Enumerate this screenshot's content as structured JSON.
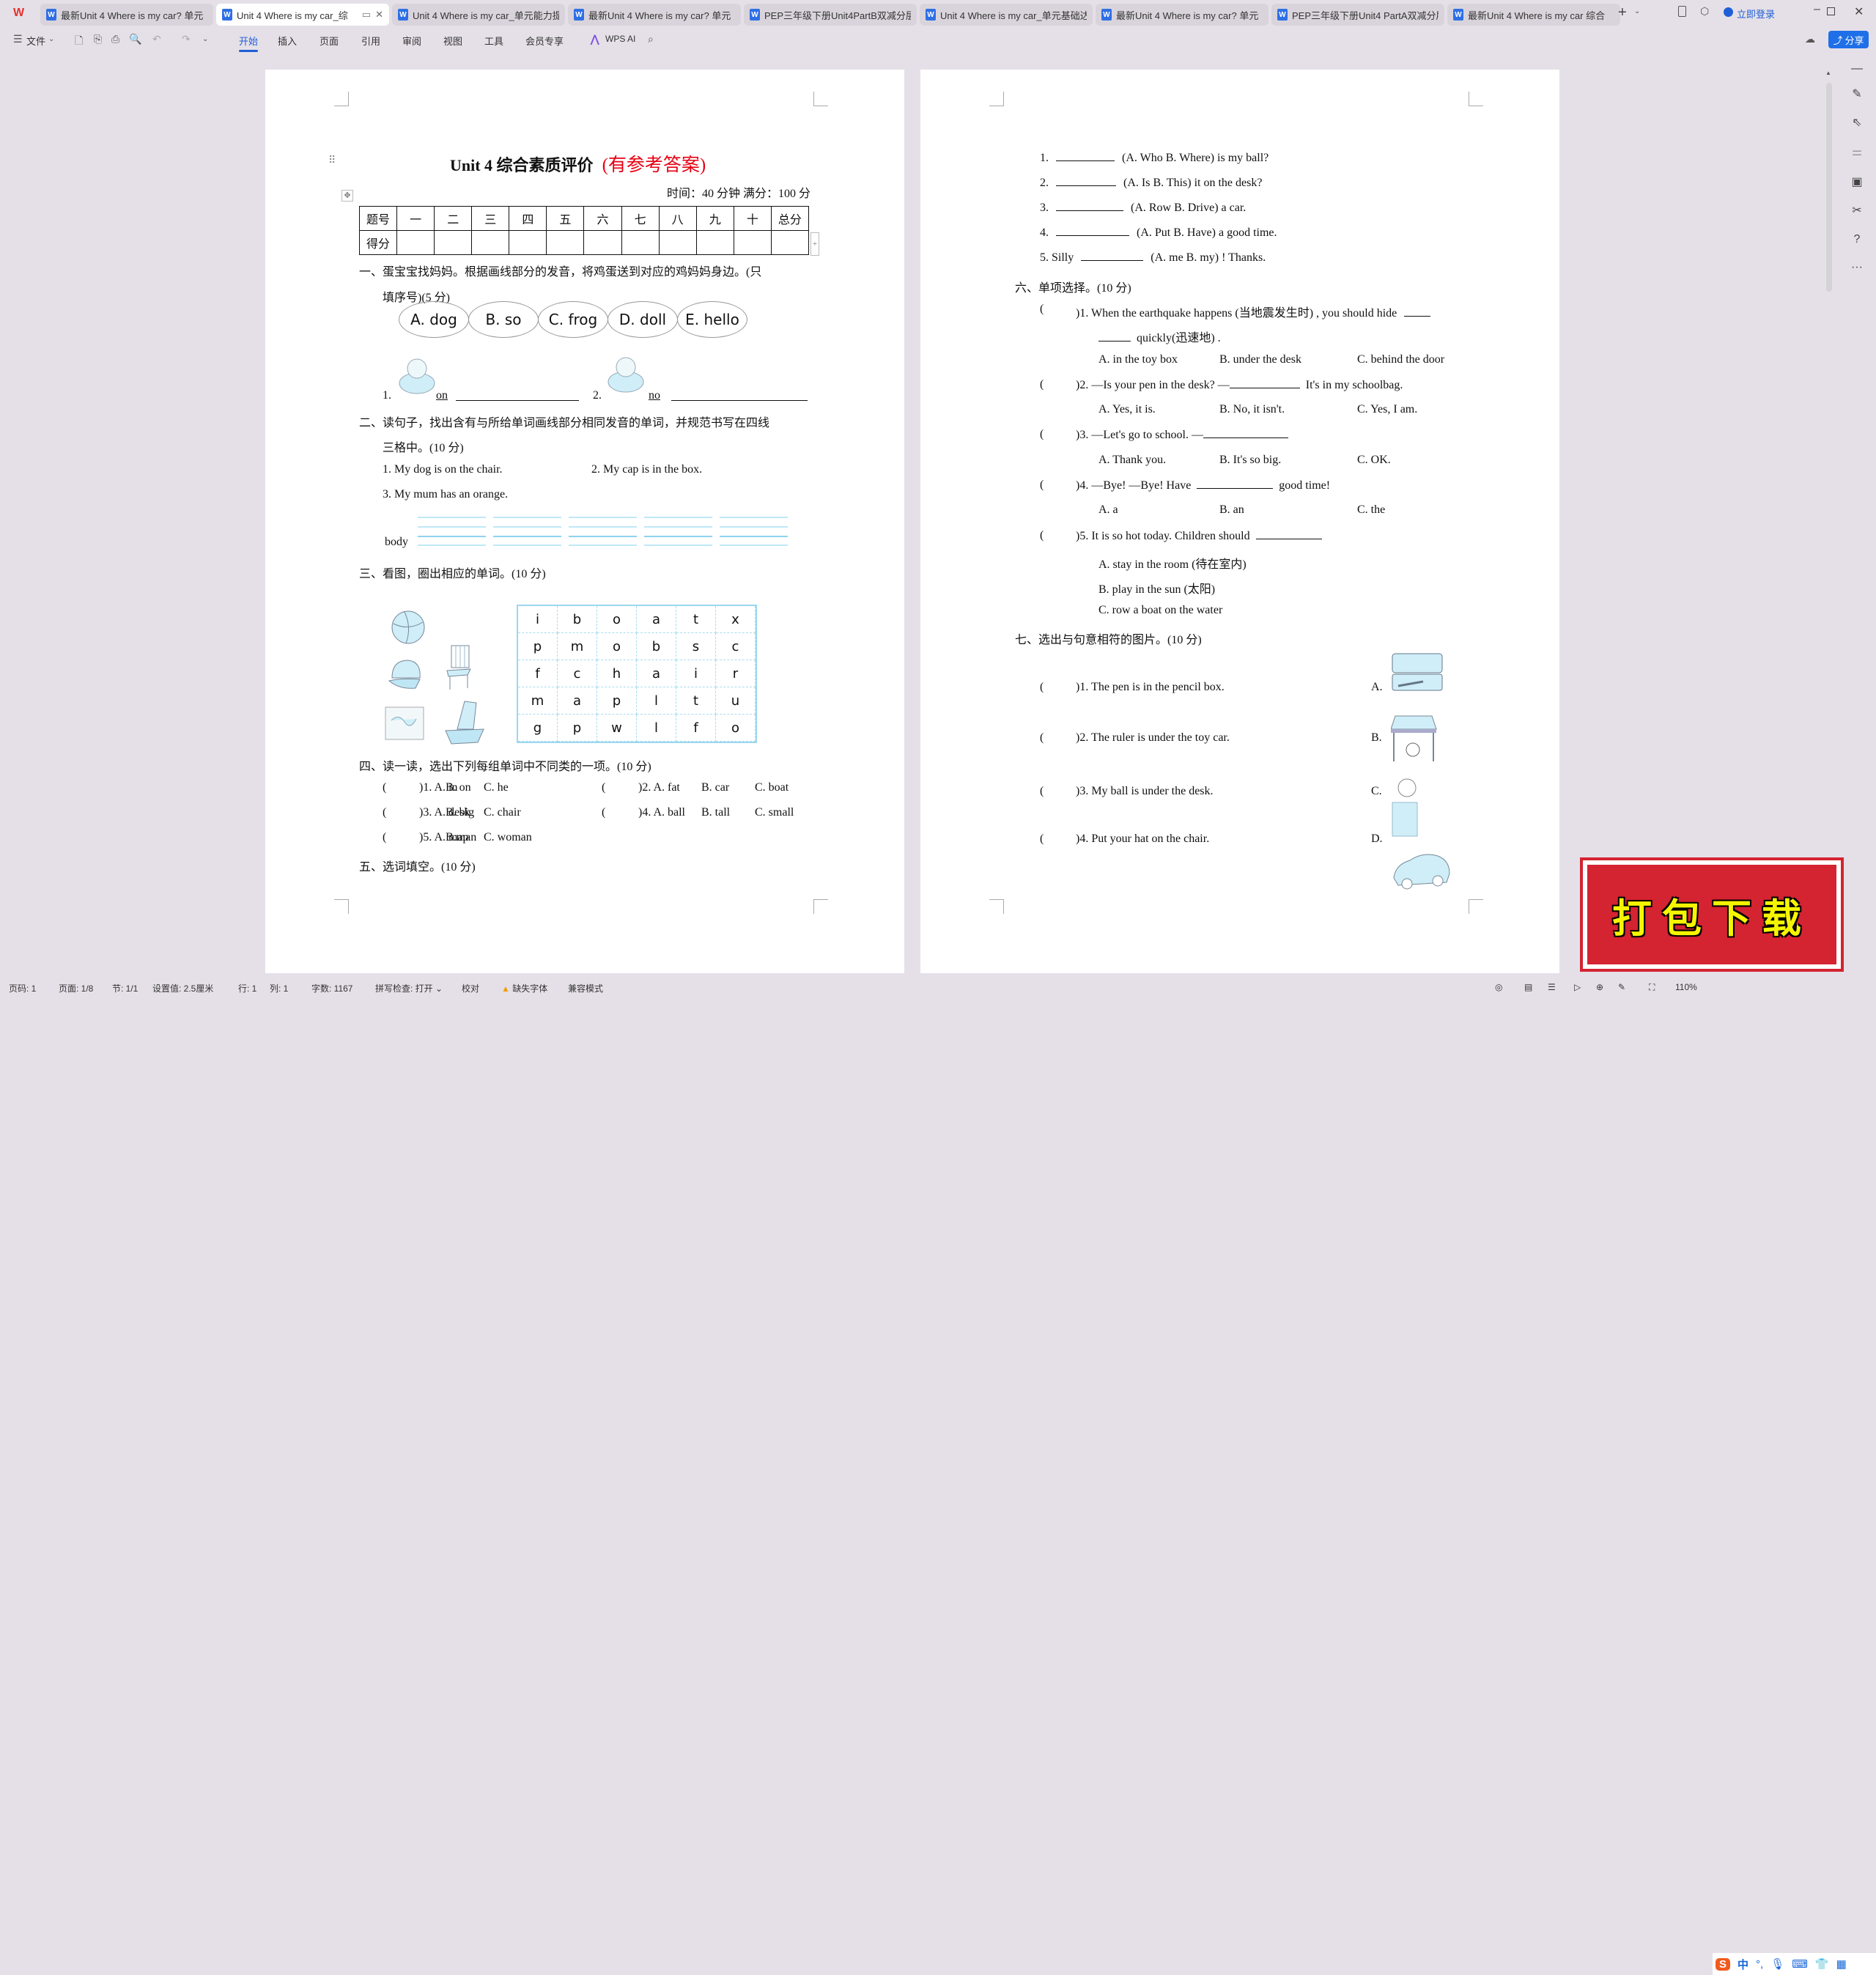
{
  "app": {
    "logo": "W",
    "login": "立即登录",
    "share": "分享"
  },
  "tabs": [
    {
      "label": "最新Unit 4 Where is my car? 单元",
      "active": false
    },
    {
      "label": "Unit 4 Where is my car_综",
      "active": true
    },
    {
      "label": "Unit 4 Where is my car_单元能力提",
      "active": false
    },
    {
      "label": "最新Unit 4 Where is my car? 单元",
      "active": false
    },
    {
      "label": "PEP三年级下册Unit4PartB双减分层",
      "active": false
    },
    {
      "label": "Unit 4 Where is my car_单元基础达",
      "active": false
    },
    {
      "label": "最新Unit 4 Where is my car? 单元",
      "active": false
    },
    {
      "label": "PEP三年级下册Unit4 PartA双减分层",
      "active": false
    },
    {
      "label": "最新Unit 4   Where is my car 综合",
      "active": false
    }
  ],
  "toolbar": {
    "file": "文件",
    "menus": [
      "开始",
      "插入",
      "页面",
      "引用",
      "审阅",
      "视图",
      "工具",
      "会员专享"
    ],
    "ai": "WPS AI"
  },
  "doc": {
    "title": "Unit 4  综合素质评价",
    "title_note": "(有参考答案)",
    "time": "时间：40 分钟    满分：100 分",
    "table": {
      "row1": [
        "题号",
        "一",
        "二",
        "三",
        "四",
        "五",
        "六",
        "七",
        "八",
        "九",
        "十",
        "总分"
      ],
      "row2_label": "得分"
    },
    "q1": {
      "heading": "一、蛋宝宝找妈妈。根据画线部分的发音，将鸡蛋送到对应的鸡妈妈身边。(只",
      "heading2": "填序号)(5 分)",
      "options": [
        "A. dog",
        "B. so",
        "C. frog",
        "D. doll",
        "E. hello"
      ],
      "item1": "1.",
      "word1": "on",
      "item2": "2.",
      "word2": "no"
    },
    "q2": {
      "heading": "二、读句子，找出含有与所给单词画线部分相同发音的单词，并规范书写在四线",
      "heading2": "三格中。(10 分)",
      "s1": "1. My dog is on the chair.",
      "s2": "2. My cap is in the box.",
      "s3": "3. My mum has an orange.",
      "word": "body"
    },
    "q3": {
      "heading": "三、看图，圈出相应的单词。(10 分)",
      "grid": [
        [
          "i",
          "b",
          "o",
          "a",
          "t",
          "x"
        ],
        [
          "p",
          "m",
          "o",
          "b",
          "s",
          "c"
        ],
        [
          "f",
          "c",
          "h",
          "a",
          "i",
          "r"
        ],
        [
          "m",
          "a",
          "p",
          "l",
          "t",
          "u"
        ],
        [
          "g",
          "p",
          "w",
          "l",
          "f",
          "o"
        ]
      ]
    },
    "q4": {
      "heading": "四、读一读，选出下列每组单词中不同类的一项。(10 分)",
      "items": [
        {
          "num": ")1. A. in",
          "b": "B. on",
          "c": "C. he"
        },
        {
          "num": ")2. A. fat",
          "b": "B. car",
          "c": "C. boat"
        },
        {
          "num": ")3. A. desk",
          "b": "B. big",
          "c": "C. chair"
        },
        {
          "num": ")4. A. ball",
          "b": "B. tall",
          "c": "C. small"
        },
        {
          "num": ")5. A. map",
          "b": "B.man",
          "c": "C. woman"
        }
      ]
    },
    "q5": {
      "heading": "五、选词填空。(10 分)",
      "items": [
        {
          "num": "1.",
          "text": "(A. Who B. Where) is my ball?"
        },
        {
          "num": "2.",
          "text": "(A. Is B. This) it on the desk?"
        },
        {
          "num": "3.",
          "text": "(A. Row B. Drive) a car."
        },
        {
          "num": "4.",
          "text": "(A. Put B. Have) a good time."
        },
        {
          "num": "5. Silly",
          "text": "(A. me B. my) ! Thanks."
        }
      ]
    },
    "q6": {
      "heading": "六、单项选择。(10 分)",
      "i1": ")1. When the earthquake happens (当地震发生时) , you should hide",
      "i1b": "quickly(迅速地) .",
      "i1o": [
        "A. in the toy box",
        "B. under the desk",
        "C. behind the door"
      ],
      "i2": ")2. —Is your pen in the desk?      —",
      "i2b": "It's in my schoolbag.",
      "i2o": [
        "A. Yes, it is.",
        "B. No, it isn't.",
        "C. Yes, I am."
      ],
      "i3": ")3. —Let's go to school. —",
      "i3o": [
        "A. Thank you.",
        "B. It's so big.",
        "C. OK."
      ],
      "i4": ")4. —Bye! —Bye! Have",
      "i4b": "good time!",
      "i4o": [
        "A. a",
        "B. an",
        "C. the"
      ],
      "i5": ")5. It is so hot today. Children should",
      "i5o": [
        "A. stay in the room (待在室内)",
        "B. play in the sun (太阳)",
        "C. row a boat on the water"
      ]
    },
    "q7": {
      "heading": "七、选出与句意相符的图片。(10 分)",
      "items": [
        ")1. The pen is in the pencil box.",
        ")2. The ruler is under the toy car.",
        ")3. My ball is under the desk.",
        ")4. Put your hat on the chair."
      ],
      "letters": [
        "A.",
        "B.",
        "C.",
        "D."
      ]
    },
    "paren": "("
  },
  "status": {
    "page_code": "页码: 1",
    "page": "页面: 1/8",
    "section": "节: 1/1",
    "setting": "设置值: 2.5厘米",
    "row": "行: 1",
    "col": "列: 1",
    "words": "字数: 1167",
    "spell": "拼写检查: 打开",
    "proof": "校对",
    "missing_font": "缺失字体",
    "compat": "兼容模式",
    "zoom": "110%"
  },
  "ime": {
    "lang": "中"
  },
  "watermark": "打包下载",
  "colors": {
    "accent": "#1f5fd6",
    "title_note": "#e60012",
    "wps_red": "#e8312f",
    "watermark_bg": "#d42331",
    "watermark_text": "#f5f500"
  }
}
